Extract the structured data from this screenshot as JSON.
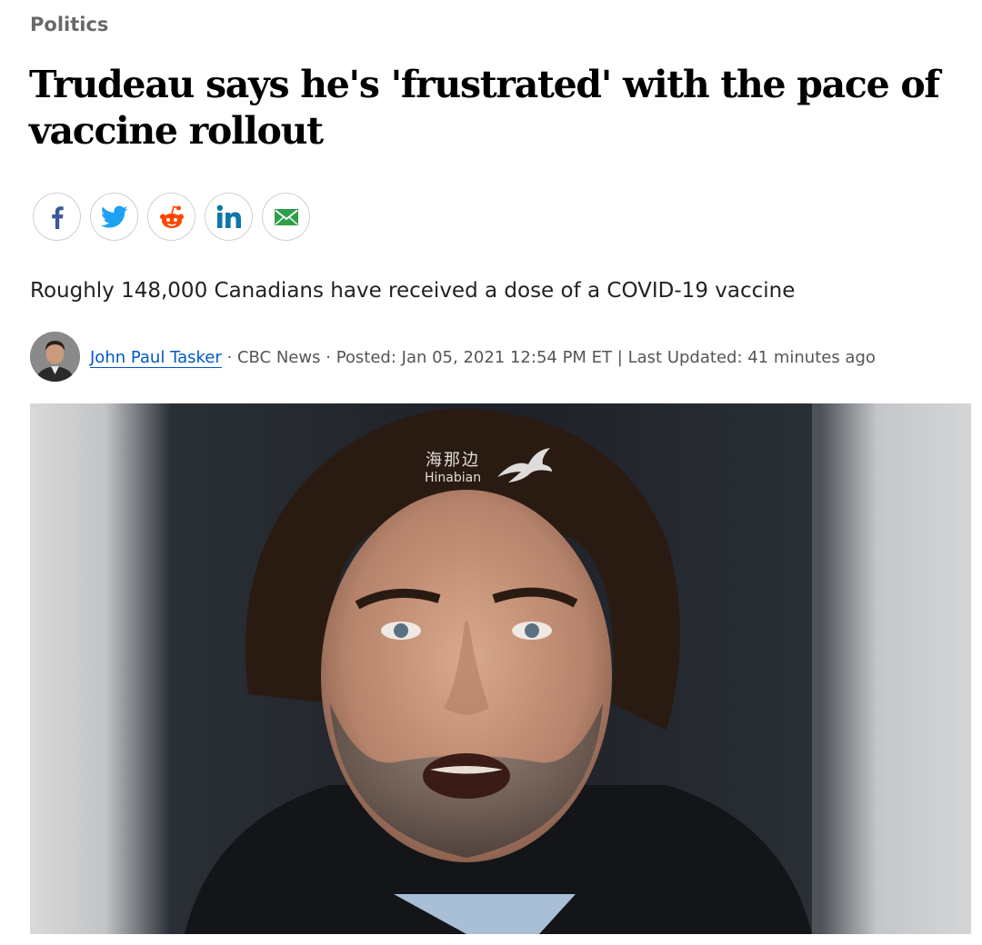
{
  "article": {
    "category": "Politics",
    "headline": "Trudeau says he's 'frustrated' with the pace of vaccine rollout",
    "deck": "Roughly 148,000 Canadians have received a dose of a COVID-19 vaccine"
  },
  "share": {
    "buttons": [
      {
        "icon": "facebook-icon",
        "color": "#3b5998"
      },
      {
        "icon": "twitter-icon",
        "color": "#1da1f2"
      },
      {
        "icon": "reddit-icon",
        "color": "#ff4500"
      },
      {
        "icon": "linkedin-icon",
        "color": "#0e76a8"
      },
      {
        "icon": "email-icon",
        "color": "#2e9e48"
      }
    ]
  },
  "byline": {
    "author": "John Paul Tasker",
    "separator": "·",
    "source": "CBC News",
    "posted": "Posted: Jan 05, 2021 12:54 PM ET",
    "pipe": "|",
    "updated": "Last Updated: 41 minutes ago"
  },
  "hero_image": {
    "watermark_cn": "海那边",
    "watermark_en": "Hinabian"
  }
}
